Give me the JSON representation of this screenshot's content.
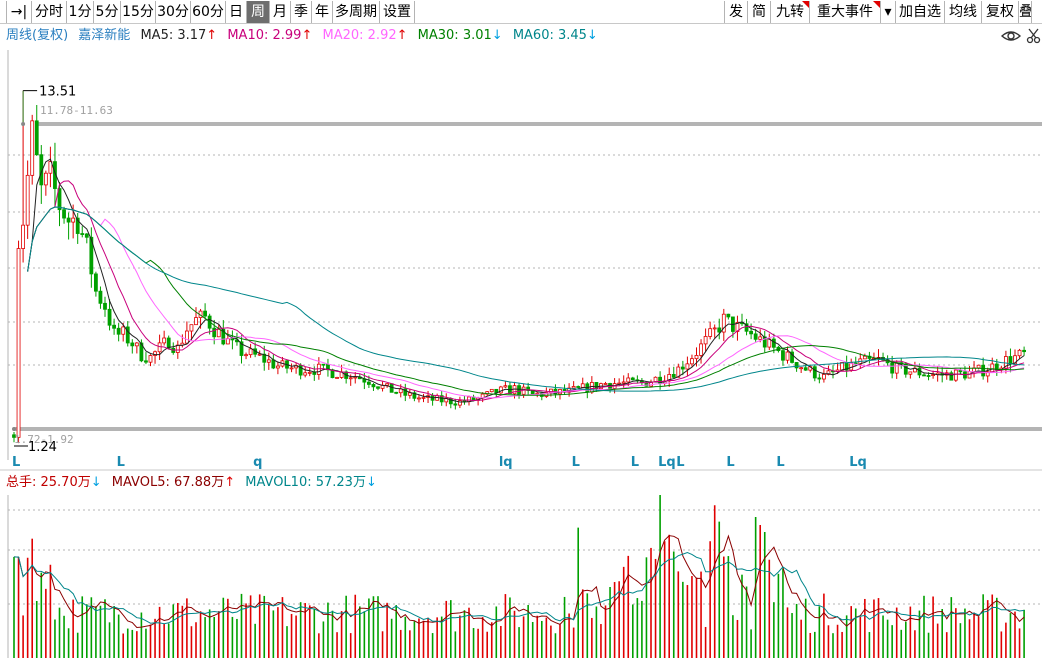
{
  "toolbar": {
    "left_items": [
      {
        "label": "→|",
        "active": false
      },
      {
        "label": "分时",
        "active": false
      },
      {
        "label": "1分",
        "active": false
      },
      {
        "label": "5分",
        "active": false
      },
      {
        "label": "15分",
        "active": false
      },
      {
        "label": "30分",
        "active": false
      },
      {
        "label": "60分",
        "active": false
      },
      {
        "label": "日",
        "active": false
      },
      {
        "label": "周",
        "active": true
      },
      {
        "label": "月",
        "active": false
      },
      {
        "label": "季",
        "active": false
      },
      {
        "label": "年",
        "active": false
      },
      {
        "label": "多周期",
        "active": false
      },
      {
        "label": "设置",
        "active": false
      }
    ],
    "right_items": [
      {
        "label": "发",
        "flag": false
      },
      {
        "label": "简",
        "flag": false
      },
      {
        "label": "九转",
        "flag": true
      },
      {
        "label": "重大事件",
        "flag": true
      },
      {
        "label": "▾",
        "flag": false
      },
      {
        "label": "加自选",
        "flag": false
      },
      {
        "label": "均线",
        "flag": false
      },
      {
        "label": "复权",
        "flag": false
      },
      {
        "label": "叠",
        "flag": false
      }
    ]
  },
  "legend": {
    "period": "周线(复权)",
    "stock_name": "嘉泽新能",
    "ma5": {
      "label": "MA5: 3.17",
      "arrow": "↑",
      "color": "#222222"
    },
    "ma10": {
      "label": "MA10: 2.99",
      "arrow": "↑",
      "color": "#c8007c"
    },
    "ma20": {
      "label": "MA20: 2.92",
      "arrow": "↑",
      "color": "#ff66ff"
    },
    "ma30": {
      "label": "MA30: 3.01",
      "arrow": "↓",
      "color": "#008000"
    },
    "ma60": {
      "label": "MA60: 3.45",
      "arrow": "↓",
      "color": "#00868b"
    },
    "up_arrow_color": "#e00000",
    "down_arrow_color": "#00a0e0"
  },
  "price_annotations": {
    "high": "13.51",
    "low": "1.24",
    "range_top": "11.78-11.63",
    "range_bottom": "1.72-1.92"
  },
  "markers": [
    {
      "label": "L",
      "bar": 0
    },
    {
      "label": "L",
      "bar": 23
    },
    {
      "label": "q",
      "bar": 53
    },
    {
      "label": "lq",
      "bar": 107
    },
    {
      "label": "L",
      "bar": 123
    },
    {
      "label": "L",
      "bar": 136
    },
    {
      "label": "Lq",
      "bar": 142
    },
    {
      "label": "L",
      "bar": 146
    },
    {
      "label": "L",
      "bar": 157
    },
    {
      "label": "L",
      "bar": 168
    },
    {
      "label": "Lq",
      "bar": 184
    }
  ],
  "volume_legend": {
    "total": {
      "label": "总手: 25.70万",
      "arrow": "↓",
      "color": "#c00000"
    },
    "mavol5": {
      "label": "MAVOL5: 67.88万",
      "arrow": "↑",
      "color": "#8b0000"
    },
    "mavol10": {
      "label": "MAVOL10: 57.23万",
      "arrow": "↓",
      "color": "#00868b"
    }
  },
  "icons": {
    "eye": "eye-icon",
    "scissors": "scissors-icon"
  },
  "chart_data": {
    "type": "candlestick",
    "period": "weekly",
    "price_high": 13.51,
    "price_low": 1.24,
    "series": [
      {
        "name": "MA5",
        "color": "#222222",
        "last": 3.17
      },
      {
        "name": "MA10",
        "color": "#c8007c",
        "last": 2.99
      },
      {
        "name": "MA20",
        "color": "#ff66ff",
        "last": 2.92
      },
      {
        "name": "MA30",
        "color": "#008000",
        "last": 3.01
      },
      {
        "name": "MA60",
        "color": "#00868b",
        "last": 3.45
      }
    ],
    "volume": {
      "total": "25.70万",
      "mavol5": "67.88万",
      "mavol10": "57.23万"
    },
    "colors": {
      "up": "#e00000",
      "down": "#00a000",
      "grid": "#b4b4b4"
    }
  }
}
